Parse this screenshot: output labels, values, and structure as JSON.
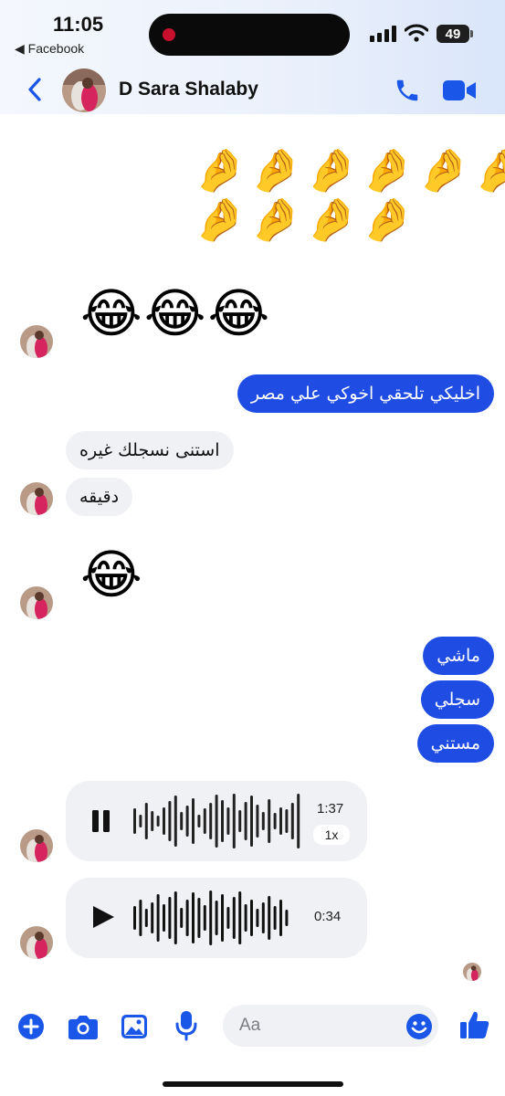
{
  "status_bar": {
    "time": "11:05",
    "back_app": "◀ Facebook",
    "battery": "49"
  },
  "header": {
    "contact_name": "D Sara Shalaby"
  },
  "messages": {
    "hand_emojis_row1": "🤌🤌🤌🤌🤌🤌",
    "hand_emojis_row2": "🤌🤌🤌🤌",
    "laugh_emojis": "😂😂😂",
    "out_1": "اخليكي تلحقي اخوكي علي مصر",
    "in_1": "استنى  نسجلك غيره",
    "in_2": "دقيقه",
    "laugh_single": "😂",
    "out_2": "ماشي",
    "out_3": "سجلي",
    "out_4": "مستني"
  },
  "voice_1": {
    "duration": "1:37",
    "speed": "1x",
    "state": "playing"
  },
  "voice_2": {
    "duration": "0:34",
    "state": "paused"
  },
  "composer": {
    "placeholder": "Aa"
  },
  "colors": {
    "accent": "#1f4de4",
    "incoming": "#f0f1f4",
    "icon_blue": "#1a56e8"
  }
}
